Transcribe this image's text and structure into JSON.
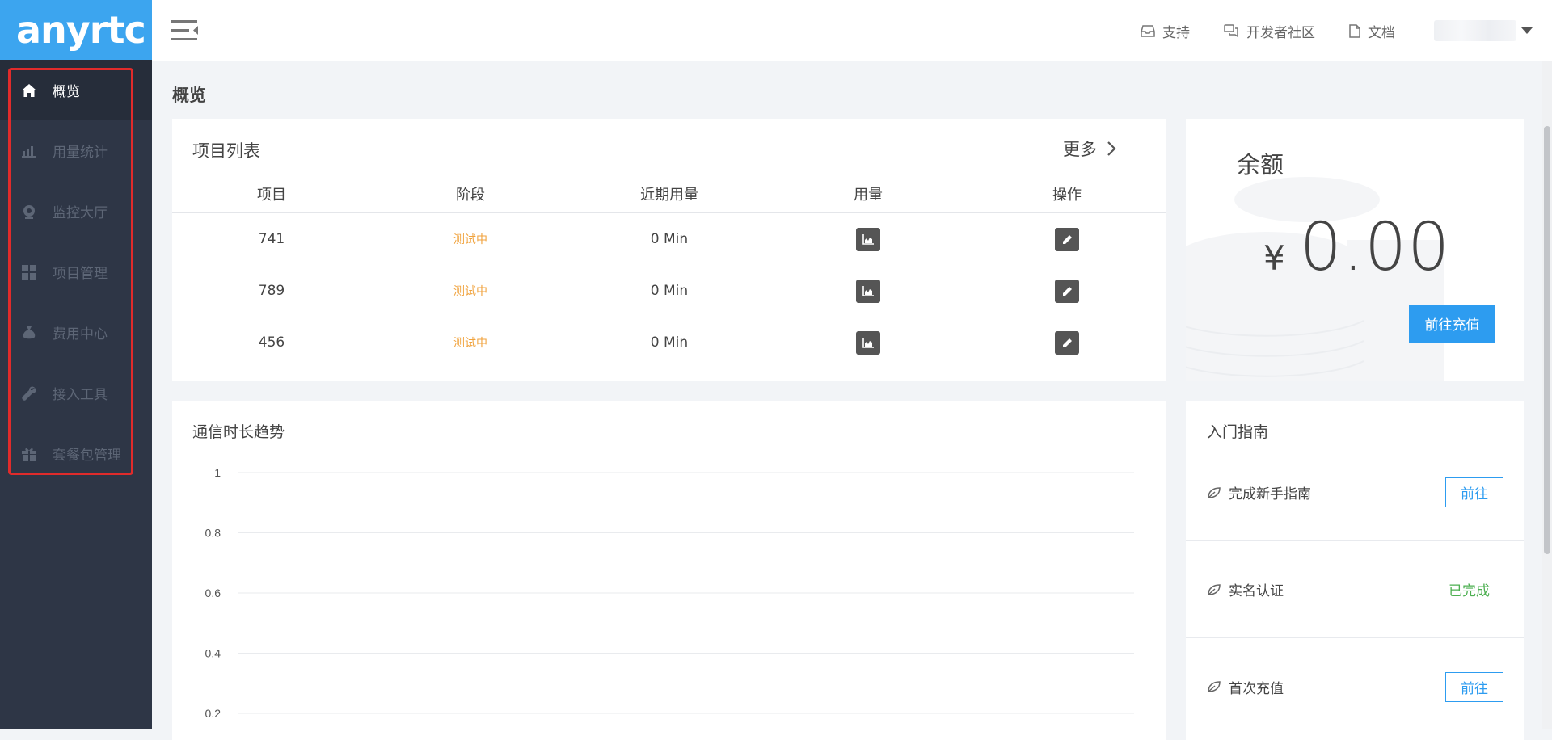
{
  "brand": {
    "logo_text": "anyrtc",
    "logo_color": "#3ca5ef"
  },
  "sidebar": {
    "items": [
      {
        "label": "概览",
        "icon": "home-icon",
        "active": true
      },
      {
        "label": "用量统计",
        "icon": "bar-chart-icon"
      },
      {
        "label": "监控大厅",
        "icon": "webcam-icon"
      },
      {
        "label": "项目管理",
        "icon": "grid-icon"
      },
      {
        "label": "费用中心",
        "icon": "money-bag-icon"
      },
      {
        "label": "接入工具",
        "icon": "wrench-icon"
      },
      {
        "label": "套餐包管理",
        "icon": "gift-icon"
      }
    ]
  },
  "topbar": {
    "links": [
      {
        "label": "支持",
        "icon": "inbox-icon"
      },
      {
        "label": "开发者社区",
        "icon": "chat-icon"
      },
      {
        "label": "文档",
        "icon": "document-icon"
      }
    ]
  },
  "page": {
    "title": "概览"
  },
  "projects": {
    "title": "项目列表",
    "more_label": "更多",
    "columns": [
      "项目",
      "阶段",
      "近期用量",
      "用量",
      "操作"
    ],
    "rows": [
      {
        "name": "741",
        "stage": "测试中",
        "usage": "0 Min"
      },
      {
        "name": "789",
        "stage": "测试中",
        "usage": "0 Min"
      },
      {
        "name": "456",
        "stage": "测试中",
        "usage": "0 Min"
      }
    ]
  },
  "balance": {
    "title": "余额",
    "currency": "¥",
    "amount": "0.00",
    "recharge_label": "前往充值"
  },
  "trend": {
    "title": "通信时长趋势"
  },
  "chart_data": {
    "type": "line",
    "title": "通信时长趋势",
    "y_ticks": [
      "1",
      "0.8",
      "0.6",
      "0.4",
      "0.2"
    ],
    "ylim": [
      0,
      1
    ],
    "grid": true,
    "series": []
  },
  "guide": {
    "title": "入门指南",
    "items": [
      {
        "label": "完成新手指南",
        "action": "前往"
      },
      {
        "label": "实名认证",
        "status": "已完成"
      },
      {
        "label": "首次充值",
        "action": "前往"
      }
    ]
  },
  "colors": {
    "accent": "#2d9cf0",
    "stage": "#f0a23c",
    "done": "#4caf50",
    "sidebar_bg": "#2e3646",
    "highlight": "#e02b2b"
  }
}
